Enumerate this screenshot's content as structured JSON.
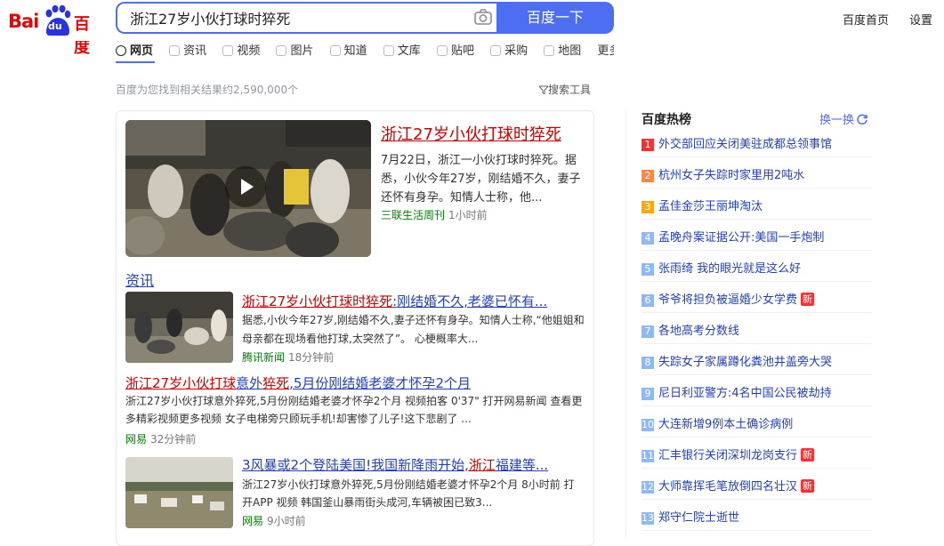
{
  "header": {
    "logo_bai": "Bai",
    "logo_du": "du",
    "logo_cn": "百度",
    "search_value": "浙江27岁小伙打球时猝死",
    "search_button": "百度一下",
    "home_link": "百度首页",
    "settings_link": "设置"
  },
  "nav": {
    "tabs": [
      {
        "label": "网页"
      },
      {
        "label": "资讯"
      },
      {
        "label": "视频"
      },
      {
        "label": "图片"
      },
      {
        "label": "知道"
      },
      {
        "label": "文库"
      },
      {
        "label": "贴吧"
      },
      {
        "label": "采购"
      },
      {
        "label": "地图"
      },
      {
        "label": "更多"
      }
    ]
  },
  "result_count": "百度为您找到相关结果约2,590,000个",
  "search_tools": "搜索工具",
  "main_result": {
    "title": "浙江27岁小伙打球时猝死",
    "snippet": "7月22日，浙江一小伙打球时猝死。据悉，小伙今年27岁，刚结婚不久，妻子还怀有身孕。知情人士称，他...",
    "source": "三联生活周刊",
    "time": "1小时前"
  },
  "news": {
    "heading": "资讯",
    "items": [
      {
        "title_em": "浙江27岁小伙打球时猝死",
        "title_rest": ":刚结婚不久,老婆已怀有...",
        "snippet": "据悉,小伙今年27岁,刚结婚不久,妻子还怀有身孕。知情人士称,“他姐姐和母亲都在现场看他打球,太突然了”。 心梗概率大...",
        "source": "腾讯新闻",
        "time": "18分钟前"
      },
      {
        "title_em1": "浙江27岁小伙打球",
        "title_mid": "意外",
        "title_em2": "猝死",
        "title_rest": ",5月份刚结婚老婆才怀孕2个月",
        "snippet": "浙江27岁小伙打球意外猝死,5月份刚结婚老婆才怀孕2个月 视频拍客 0'37\" 打开网易新闻 查看更多精彩视频更多视频 女子电梯旁只顾玩手机!却害惨了儿子!这下悲剧了 ...",
        "source": "网易",
        "time": "32分钟前"
      },
      {
        "title_pre": "3风暴或2个登陆美国!我国新降雨开始,",
        "title_em": "浙江",
        "title_rest": "福建等...",
        "snippet": "浙江27岁小伙打球意外猝死,5月份刚结婚老婆才怀孕2个月 8小时前 打开APP 视频 韩国釜山暴雨街头成河,车辆被困已致3...",
        "source": "网易",
        "time": "9小时前"
      }
    ]
  },
  "hot": {
    "title": "百度热榜",
    "refresh": "换一换",
    "items": [
      {
        "rank": "1",
        "text": "外交部回应关闭美驻成都总领事馆",
        "color": "#f73131",
        "new": ""
      },
      {
        "rank": "2",
        "text": "杭州女子失踪时家里用2吨水",
        "color": "#ff8547",
        "new": ""
      },
      {
        "rank": "3",
        "text": "孟佳金莎王丽坤淘汰",
        "color": "#faa90e",
        "new": ""
      },
      {
        "rank": "4",
        "text": "孟晚舟案证据公开:美国一手炮制",
        "color": "#8eb9f5",
        "new": ""
      },
      {
        "rank": "5",
        "text": "张雨绮 我的眼光就是这么好",
        "color": "#8eb9f5",
        "new": ""
      },
      {
        "rank": "6",
        "text": "爷爷将担负被逼婚少女学费",
        "color": "#8eb9f5",
        "new": "新"
      },
      {
        "rank": "7",
        "text": "各地高考分数线",
        "color": "#8eb9f5",
        "new": ""
      },
      {
        "rank": "8",
        "text": "失踪女子家属蹲化粪池井盖旁大哭",
        "color": "#8eb9f5",
        "new": ""
      },
      {
        "rank": "9",
        "text": "尼日利亚警方:4名中国公民被劫持",
        "color": "#8eb9f5",
        "new": ""
      },
      {
        "rank": "10",
        "text": "大连新增9例本土确诊病例",
        "color": "#8eb9f5",
        "new": ""
      },
      {
        "rank": "11",
        "text": "汇丰银行关闭深圳龙岗支行",
        "color": "#8eb9f5",
        "new": "新"
      },
      {
        "rank": "12",
        "text": "大师靠挥毛笔放倒四名壮汉",
        "color": "#8eb9f5",
        "new": "新"
      },
      {
        "rank": "13",
        "text": "郑守仁院士逝世",
        "color": "#8eb9f5",
        "new": ""
      }
    ]
  }
}
